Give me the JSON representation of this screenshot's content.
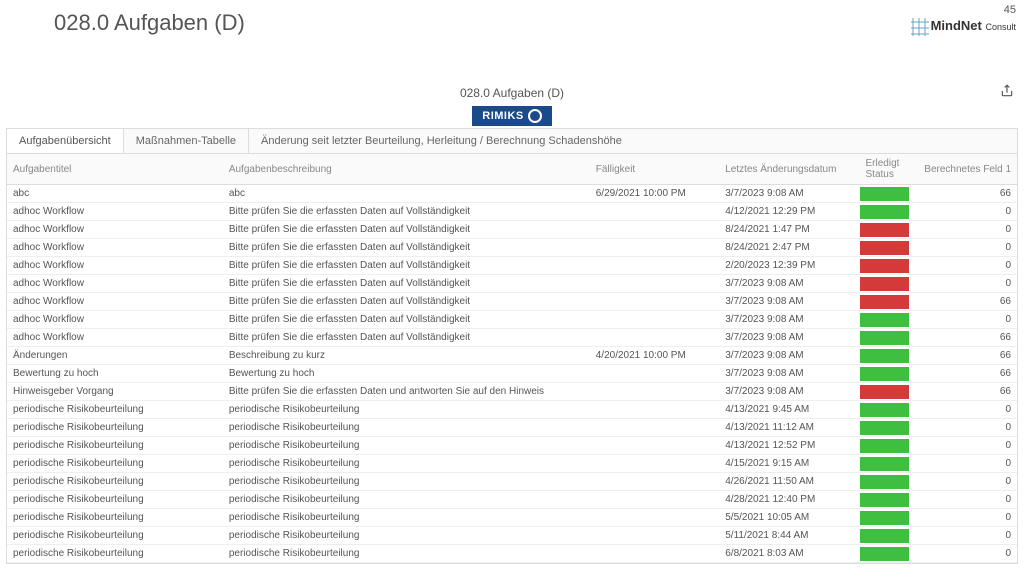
{
  "page_number": "45",
  "brand_name": "MindNet",
  "brand_suffix": "Consult",
  "title": "028.0 Aufgaben (D)",
  "subtitle": "028.0 Aufgaben (D)",
  "report_brand": "RIMIKS",
  "tabs": [
    "Aufgabenübersicht",
    "Maßnahmen-Tabelle",
    "Änderung seit letzter Beurteilung, Herleitung / Berechnung Schadenshöhe"
  ],
  "columns": {
    "c0": "Aufgabentitel",
    "c1": "Aufgabenbeschreibung",
    "c2": "Fälligkeit",
    "c3": "Letztes Änderungsdatum",
    "c4": "Erledigt Status",
    "c5": "Berechnetes Feld 1"
  },
  "rows": [
    {
      "title": "abc",
      "desc": "abc",
      "due": "6/29/2021 10:00 PM",
      "chg": "3/7/2023 9:08 AM",
      "st": "green",
      "calc": "66"
    },
    {
      "title": "adhoc Workflow",
      "desc": "Bitte prüfen Sie die erfassten Daten auf Vollständigkeit",
      "due": "",
      "chg": "4/12/2021 12:29 PM",
      "st": "green",
      "calc": "0"
    },
    {
      "title": "adhoc Workflow",
      "desc": "Bitte prüfen Sie die erfassten Daten auf Vollständigkeit",
      "due": "",
      "chg": "8/24/2021 1:47 PM",
      "st": "red",
      "calc": "0"
    },
    {
      "title": "adhoc Workflow",
      "desc": "Bitte prüfen Sie die erfassten Daten auf Vollständigkeit",
      "due": "",
      "chg": "8/24/2021 2:47 PM",
      "st": "red",
      "calc": "0"
    },
    {
      "title": "adhoc Workflow",
      "desc": "Bitte prüfen Sie die erfassten Daten auf Vollständigkeit",
      "due": "",
      "chg": "2/20/2023 12:39 PM",
      "st": "red",
      "calc": "0"
    },
    {
      "title": "adhoc Workflow",
      "desc": "Bitte prüfen Sie die erfassten Daten auf Vollständigkeit",
      "due": "",
      "chg": "3/7/2023 9:08 AM",
      "st": "red",
      "calc": "0"
    },
    {
      "title": "adhoc Workflow",
      "desc": "Bitte prüfen Sie die erfassten Daten auf Vollständigkeit",
      "due": "",
      "chg": "3/7/2023 9:08 AM",
      "st": "red",
      "calc": "66"
    },
    {
      "title": "adhoc Workflow",
      "desc": "Bitte prüfen Sie die erfassten Daten auf Vollständigkeit",
      "due": "",
      "chg": "3/7/2023 9:08 AM",
      "st": "green",
      "calc": "0"
    },
    {
      "title": "adhoc Workflow",
      "desc": "Bitte prüfen Sie die erfassten Daten auf Vollständigkeit",
      "due": "",
      "chg": "3/7/2023 9:08 AM",
      "st": "green",
      "calc": "66"
    },
    {
      "title": "Änderungen",
      "desc": "Beschreibung zu kurz",
      "due": "4/20/2021 10:00 PM",
      "chg": "3/7/2023 9:08 AM",
      "st": "green",
      "calc": "66"
    },
    {
      "title": "Bewertung zu hoch",
      "desc": "Bewertung zu hoch",
      "due": "",
      "chg": "3/7/2023 9:08 AM",
      "st": "green",
      "calc": "66"
    },
    {
      "title": "Hinweisgeber Vorgang",
      "desc": "Bitte prüfen Sie die erfassten Daten und antworten Sie auf den Hinweis",
      "due": "",
      "chg": "3/7/2023 9:08 AM",
      "st": "red",
      "calc": "66"
    },
    {
      "title": "periodische Risikobeurteilung",
      "desc": "periodische Risikobeurteilung",
      "due": "",
      "chg": "4/13/2021 9:45 AM",
      "st": "green",
      "calc": "0"
    },
    {
      "title": "periodische Risikobeurteilung",
      "desc": "periodische Risikobeurteilung",
      "due": "",
      "chg": "4/13/2021 11:12 AM",
      "st": "green",
      "calc": "0"
    },
    {
      "title": "periodische Risikobeurteilung",
      "desc": "periodische Risikobeurteilung",
      "due": "",
      "chg": "4/13/2021 12:52 PM",
      "st": "green",
      "calc": "0"
    },
    {
      "title": "periodische Risikobeurteilung",
      "desc": "periodische Risikobeurteilung",
      "due": "",
      "chg": "4/15/2021 9:15 AM",
      "st": "green",
      "calc": "0"
    },
    {
      "title": "periodische Risikobeurteilung",
      "desc": "periodische Risikobeurteilung",
      "due": "",
      "chg": "4/26/2021 11:50 AM",
      "st": "green",
      "calc": "0"
    },
    {
      "title": "periodische Risikobeurteilung",
      "desc": "periodische Risikobeurteilung",
      "due": "",
      "chg": "4/28/2021 12:40 PM",
      "st": "green",
      "calc": "0"
    },
    {
      "title": "periodische Risikobeurteilung",
      "desc": "periodische Risikobeurteilung",
      "due": "",
      "chg": "5/5/2021 10:05 AM",
      "st": "green",
      "calc": "0"
    },
    {
      "title": "periodische Risikobeurteilung",
      "desc": "periodische Risikobeurteilung",
      "due": "",
      "chg": "5/11/2021 8:44 AM",
      "st": "green",
      "calc": "0"
    },
    {
      "title": "periodische Risikobeurteilung",
      "desc": "periodische Risikobeurteilung",
      "due": "",
      "chg": "6/8/2021 8:03 AM",
      "st": "green",
      "calc": "0"
    }
  ]
}
